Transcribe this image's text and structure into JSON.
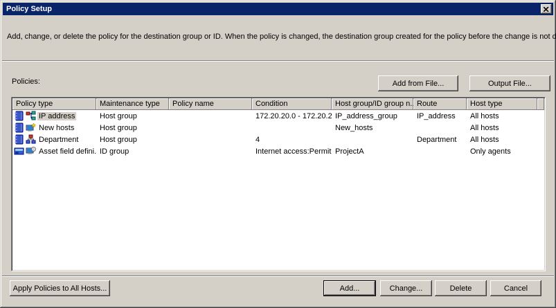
{
  "window": {
    "title": "Policy Setup"
  },
  "description": "Add, change, or delete the policy for the destination group or ID. When the policy is changed, the destination group created for the policy before the change is not deleted.",
  "policies_label": "Policies:",
  "toolbar": {
    "add_from_file": "Add from File...",
    "output_file": "Output File..."
  },
  "table": {
    "columns": [
      "Policy type",
      "Maintenance type",
      "Policy name",
      "Condition",
      "Host group/ID group n...",
      "Route",
      "Host type"
    ],
    "rows": [
      {
        "icons": [
          "address-book-icon",
          "ip-network-icon"
        ],
        "policy_type": "IP address",
        "maintenance_type": "Host group",
        "policy_name": "",
        "condition": "172.20.20.0 - 172.20.2...",
        "host_group": "IP_address_group",
        "route": "IP_address",
        "host_type": "All hosts",
        "selected": true
      },
      {
        "icons": [
          "address-book-icon",
          "new-host-icon"
        ],
        "policy_type": "New hosts",
        "maintenance_type": "Host group",
        "policy_name": "",
        "condition": "",
        "host_group": "New_hosts",
        "route": "",
        "host_type": "All hosts",
        "selected": false
      },
      {
        "icons": [
          "address-book-icon",
          "department-tree-icon"
        ],
        "policy_type": "Department",
        "maintenance_type": "Host group",
        "policy_name": "",
        "condition": "4",
        "host_group": "",
        "route": "Department",
        "host_type": "All hosts",
        "selected": false
      },
      {
        "icons": [
          "asset-field-icon",
          "agent-monitor-icon"
        ],
        "policy_type": "Asset field defini...",
        "maintenance_type": "ID group",
        "policy_name": "",
        "condition": "Internet access:Permit",
        "host_group": "ProjectA",
        "route": "",
        "host_type": "Only agents",
        "selected": false
      }
    ]
  },
  "footer": {
    "apply_all": "Apply Policies to All Hosts...",
    "add": "Add...",
    "change": "Change...",
    "delete": "Delete",
    "cancel": "Cancel"
  },
  "colors": {
    "titlebar": "#0a246a",
    "dialog_bg": "#d4d0c8",
    "selection_bg": "#d4d0c8"
  }
}
